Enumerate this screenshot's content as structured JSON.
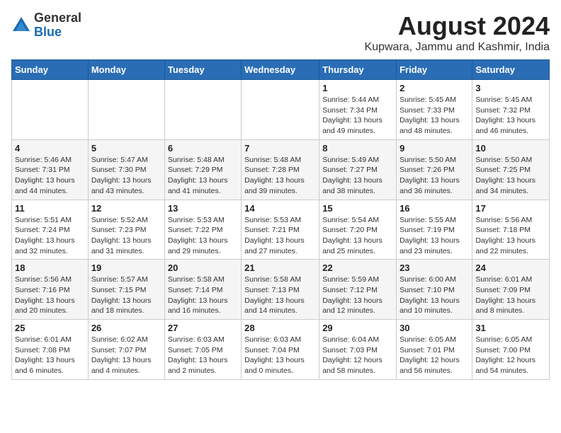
{
  "logo": {
    "general": "General",
    "blue": "Blue"
  },
  "title": {
    "month_year": "August 2024",
    "location": "Kupwara, Jammu and Kashmir, India"
  },
  "headers": [
    "Sunday",
    "Monday",
    "Tuesday",
    "Wednesday",
    "Thursday",
    "Friday",
    "Saturday"
  ],
  "weeks": [
    [
      {
        "day": "",
        "info": ""
      },
      {
        "day": "",
        "info": ""
      },
      {
        "day": "",
        "info": ""
      },
      {
        "day": "",
        "info": ""
      },
      {
        "day": "1",
        "info": "Sunrise: 5:44 AM\nSunset: 7:34 PM\nDaylight: 13 hours\nand 49 minutes."
      },
      {
        "day": "2",
        "info": "Sunrise: 5:45 AM\nSunset: 7:33 PM\nDaylight: 13 hours\nand 48 minutes."
      },
      {
        "day": "3",
        "info": "Sunrise: 5:45 AM\nSunset: 7:32 PM\nDaylight: 13 hours\nand 46 minutes."
      }
    ],
    [
      {
        "day": "4",
        "info": "Sunrise: 5:46 AM\nSunset: 7:31 PM\nDaylight: 13 hours\nand 44 minutes."
      },
      {
        "day": "5",
        "info": "Sunrise: 5:47 AM\nSunset: 7:30 PM\nDaylight: 13 hours\nand 43 minutes."
      },
      {
        "day": "6",
        "info": "Sunrise: 5:48 AM\nSunset: 7:29 PM\nDaylight: 13 hours\nand 41 minutes."
      },
      {
        "day": "7",
        "info": "Sunrise: 5:48 AM\nSunset: 7:28 PM\nDaylight: 13 hours\nand 39 minutes."
      },
      {
        "day": "8",
        "info": "Sunrise: 5:49 AM\nSunset: 7:27 PM\nDaylight: 13 hours\nand 38 minutes."
      },
      {
        "day": "9",
        "info": "Sunrise: 5:50 AM\nSunset: 7:26 PM\nDaylight: 13 hours\nand 36 minutes."
      },
      {
        "day": "10",
        "info": "Sunrise: 5:50 AM\nSunset: 7:25 PM\nDaylight: 13 hours\nand 34 minutes."
      }
    ],
    [
      {
        "day": "11",
        "info": "Sunrise: 5:51 AM\nSunset: 7:24 PM\nDaylight: 13 hours\nand 32 minutes."
      },
      {
        "day": "12",
        "info": "Sunrise: 5:52 AM\nSunset: 7:23 PM\nDaylight: 13 hours\nand 31 minutes."
      },
      {
        "day": "13",
        "info": "Sunrise: 5:53 AM\nSunset: 7:22 PM\nDaylight: 13 hours\nand 29 minutes."
      },
      {
        "day": "14",
        "info": "Sunrise: 5:53 AM\nSunset: 7:21 PM\nDaylight: 13 hours\nand 27 minutes."
      },
      {
        "day": "15",
        "info": "Sunrise: 5:54 AM\nSunset: 7:20 PM\nDaylight: 13 hours\nand 25 minutes."
      },
      {
        "day": "16",
        "info": "Sunrise: 5:55 AM\nSunset: 7:19 PM\nDaylight: 13 hours\nand 23 minutes."
      },
      {
        "day": "17",
        "info": "Sunrise: 5:56 AM\nSunset: 7:18 PM\nDaylight: 13 hours\nand 22 minutes."
      }
    ],
    [
      {
        "day": "18",
        "info": "Sunrise: 5:56 AM\nSunset: 7:16 PM\nDaylight: 13 hours\nand 20 minutes."
      },
      {
        "day": "19",
        "info": "Sunrise: 5:57 AM\nSunset: 7:15 PM\nDaylight: 13 hours\nand 18 minutes."
      },
      {
        "day": "20",
        "info": "Sunrise: 5:58 AM\nSunset: 7:14 PM\nDaylight: 13 hours\nand 16 minutes."
      },
      {
        "day": "21",
        "info": "Sunrise: 5:58 AM\nSunset: 7:13 PM\nDaylight: 13 hours\nand 14 minutes."
      },
      {
        "day": "22",
        "info": "Sunrise: 5:59 AM\nSunset: 7:12 PM\nDaylight: 13 hours\nand 12 minutes."
      },
      {
        "day": "23",
        "info": "Sunrise: 6:00 AM\nSunset: 7:10 PM\nDaylight: 13 hours\nand 10 minutes."
      },
      {
        "day": "24",
        "info": "Sunrise: 6:01 AM\nSunset: 7:09 PM\nDaylight: 13 hours\nand 8 minutes."
      }
    ],
    [
      {
        "day": "25",
        "info": "Sunrise: 6:01 AM\nSunset: 7:08 PM\nDaylight: 13 hours\nand 6 minutes."
      },
      {
        "day": "26",
        "info": "Sunrise: 6:02 AM\nSunset: 7:07 PM\nDaylight: 13 hours\nand 4 minutes."
      },
      {
        "day": "27",
        "info": "Sunrise: 6:03 AM\nSunset: 7:05 PM\nDaylight: 13 hours\nand 2 minutes."
      },
      {
        "day": "28",
        "info": "Sunrise: 6:03 AM\nSunset: 7:04 PM\nDaylight: 13 hours\nand 0 minutes."
      },
      {
        "day": "29",
        "info": "Sunrise: 6:04 AM\nSunset: 7:03 PM\nDaylight: 12 hours\nand 58 minutes."
      },
      {
        "day": "30",
        "info": "Sunrise: 6:05 AM\nSunset: 7:01 PM\nDaylight: 12 hours\nand 56 minutes."
      },
      {
        "day": "31",
        "info": "Sunrise: 6:05 AM\nSunset: 7:00 PM\nDaylight: 12 hours\nand 54 minutes."
      }
    ]
  ]
}
